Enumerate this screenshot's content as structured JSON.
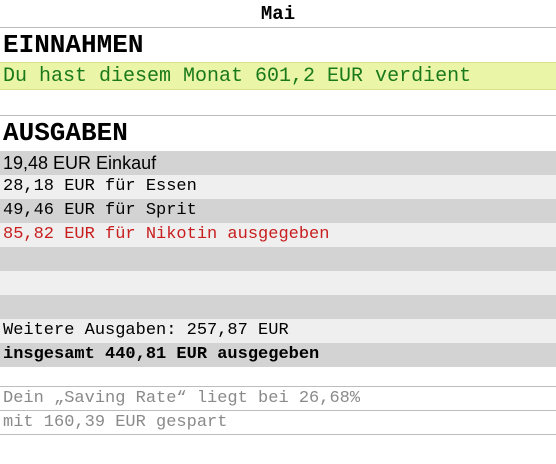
{
  "title": "Mai",
  "income": {
    "heading": "EINNAHMEN",
    "summary": "Du hast diesem Monat 601,2 EUR verdient"
  },
  "expenses": {
    "heading": "AUSGABEN",
    "items": [
      "19,48 EUR Einkauf",
      "28,18 EUR für Essen",
      "49,46 EUR für Sprit",
      "85,82 EUR für Nikotin ausgegeben"
    ],
    "further": "Weitere Ausgaben: 257,87 EUR",
    "total": "insgesamt 440,81 EUR ausgegeben"
  },
  "savings": {
    "rate": "Dein „Saving Rate“ liegt bei 26,68%",
    "saved": "mit 160,39 EUR gespart"
  },
  "colors": {
    "income_text": "#1a7a1a",
    "income_background": "#eaf5a8",
    "nicotine_text": "#c81e1e",
    "savings_text": "#8a8a8a"
  }
}
